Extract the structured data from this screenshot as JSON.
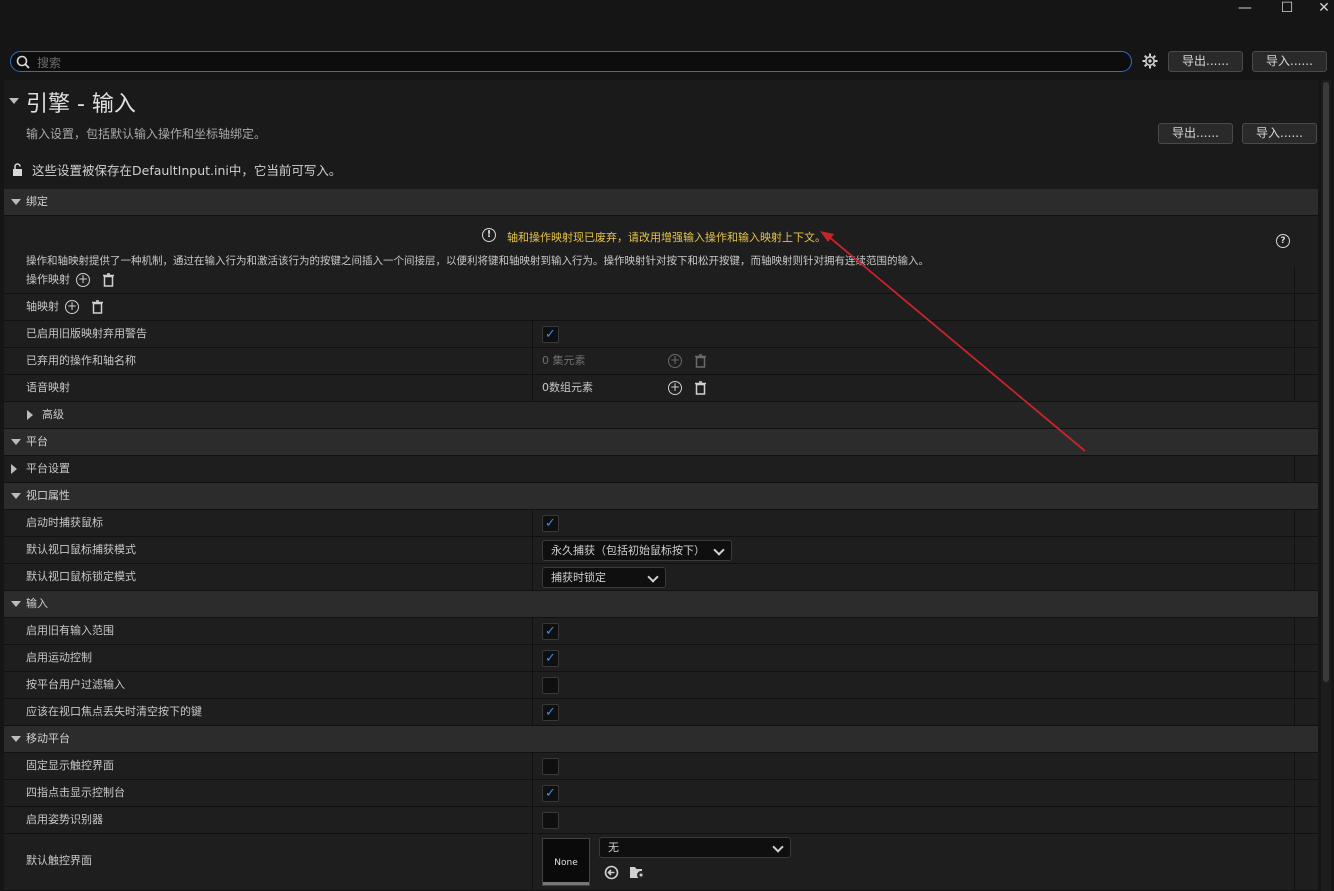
{
  "window": {
    "minimize": "—",
    "maximize": "☐",
    "close": "✕"
  },
  "search": {
    "placeholder": "搜索"
  },
  "toolbar": {
    "export_label": "导出......",
    "import_label": "导入......"
  },
  "page": {
    "title": "引擎 - 输入",
    "subtitle": "输入设置，包括默认输入操作和坐标轴绑定。",
    "export_label": "导出......",
    "import_label": "导入......",
    "save_note": "这些设置被保存在DefaultInput.ini中，它当前可写入。"
  },
  "bindings": {
    "category": "绑定",
    "warning": "轴和操作映射现已废弃，请改用增强输入操作和输入映射上下文。",
    "description": "操作和轴映射提供了一种机制，通过在输入行为和激活该行为的按键之间插入一个间接层，以便利将键和轴映射到输入行为。操作映射针对按下和松开按键，而轴映射则针对拥有连续范围的输入。",
    "action_mappings": "操作映射",
    "axis_mappings": "轴映射",
    "legacy_warning_label": "已启用旧版映射弃用警告",
    "legacy_warning_checked": true,
    "deprecated_names_label": "已弃用的操作和轴名称",
    "deprecated_names_value": "0 集元素",
    "speech_label": "语音映射",
    "speech_value": "0数组元素",
    "advanced": "高级"
  },
  "platform": {
    "category": "平台",
    "settings": "平台设置"
  },
  "viewport": {
    "category": "视口属性",
    "capture_label": "启动时捕获鼠标",
    "capture_checked": true,
    "capture_mode_label": "默认视口鼠标捕获模式",
    "capture_mode_value": "永久捕获（包括初始鼠标按下）",
    "lock_mode_label": "默认视口鼠标锁定模式",
    "lock_mode_value": "捕获时锁定"
  },
  "input": {
    "category": "输入",
    "items": [
      {
        "label": "启用旧有输入范围",
        "checked": true
      },
      {
        "label": "启用运动控制",
        "checked": true
      },
      {
        "label": "按平台用户过滤输入",
        "checked": false
      },
      {
        "label": "应该在视口焦点丢失时清空按下的键",
        "checked": true
      }
    ]
  },
  "mobile": {
    "category": "移动平台",
    "items": [
      {
        "label": "固定显示触控界面",
        "checked": false
      },
      {
        "label": "四指点击显示控制台",
        "checked": true
      },
      {
        "label": "启用姿势识别器",
        "checked": false
      }
    ],
    "default_touch_label": "默认触控界面",
    "thumb_text": "None",
    "default_touch_value": "无"
  },
  "colors": {
    "accent": "#2a6fc9",
    "check": "#3a8ee6",
    "warning": "#e6c24a",
    "annotation_arrow": "#c8232c"
  }
}
